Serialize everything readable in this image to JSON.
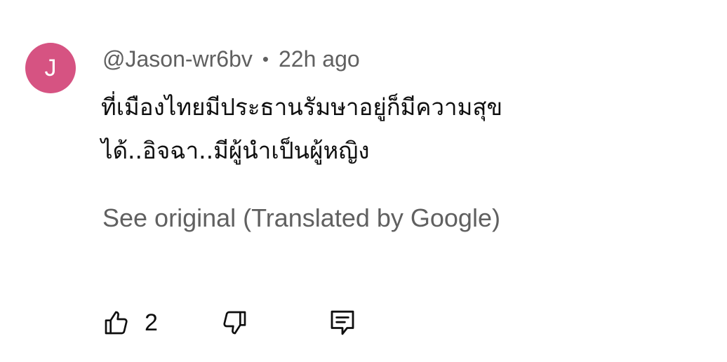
{
  "comment": {
    "avatar_initial": "J",
    "avatar_color": "#d65382",
    "author": "@Jason-wr6bv",
    "separator": "•",
    "time": "22h ago",
    "text": "ที่เมืองไทยมีประธานรัมษาอยู่ก็มีความสุข\nได้..อิจฉา..มีผู้นำเป็นผู้หญิง",
    "see_original": "See original (Translated by Google)"
  },
  "actions": {
    "like_icon": "thumbs-up-icon",
    "like_count": "2",
    "dislike_icon": "thumbs-down-icon",
    "reply_icon": "reply-comment-icon"
  }
}
